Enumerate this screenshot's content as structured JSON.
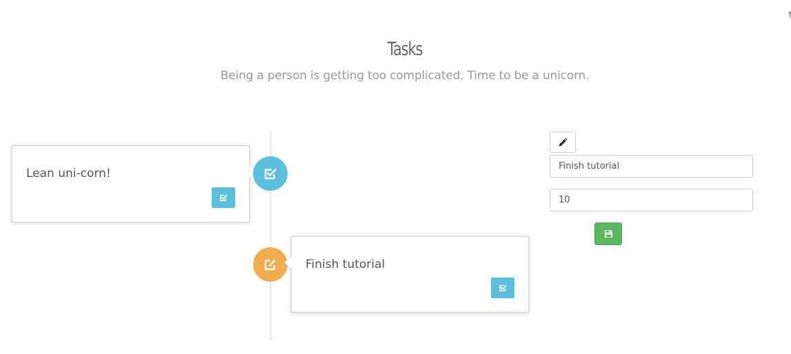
{
  "header": {
    "title": "Tasks",
    "subtitle": "Being a person is getting too complicated. Time to be a unicorn."
  },
  "timeline": {
    "tasks": [
      {
        "title": "Lean uni-corn!",
        "status": "done",
        "badge_icon": "check-square-icon",
        "action_icon": "check-square-icon"
      },
      {
        "title": "Finish tutorial",
        "status": "editing",
        "badge_icon": "edit-square-icon",
        "action_icon": "check-square-icon"
      }
    ]
  },
  "edit_form": {
    "edit_icon": "pencil-icon",
    "title_value": "Finish tutorial",
    "points_value": "10",
    "save_icon": "floppy-disk-icon"
  },
  "colors": {
    "info": "#5bc0de",
    "warning": "#f0ad4e",
    "success": "#5cb85c"
  }
}
